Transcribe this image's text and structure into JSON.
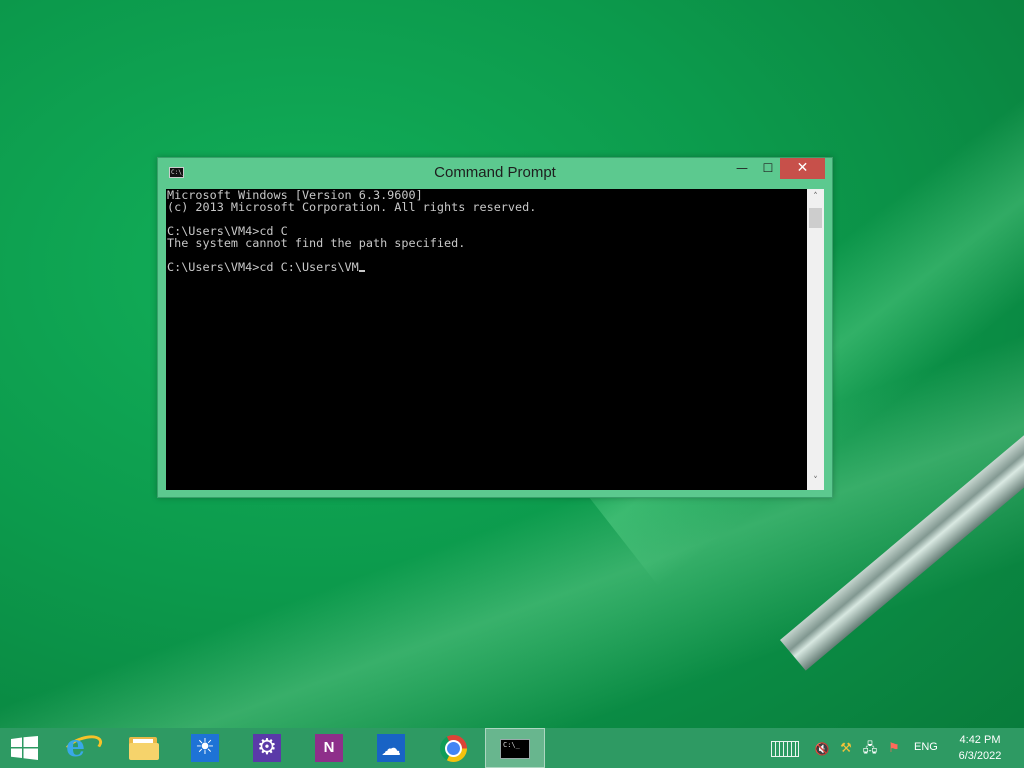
{
  "window": {
    "title": "Command Prompt",
    "controls": {
      "minimize": "—",
      "maximize": "☐",
      "close": "✕"
    }
  },
  "console": {
    "lines": [
      "Microsoft Windows [Version 6.3.9600]",
      "(c) 2013 Microsoft Corporation. All rights reserved.",
      "",
      "C:\\Users\\VM4>cd C",
      "The system cannot find the path specified.",
      "",
      "C:\\Users\\VM4>cd C:\\Users\\VM"
    ]
  },
  "scrollbar": {
    "up": "˄",
    "down": "˅"
  },
  "taskbar": {
    "icons": [
      "windows-start-icon",
      "internet-explorer-icon",
      "file-explorer-icon",
      "weather-icon",
      "settings-icon",
      "onenote-icon",
      "onedrive-icon",
      "chrome-icon",
      "command-prompt-icon"
    ],
    "onenote_label": "N",
    "cmd_icon_text": "C:\\_"
  },
  "tray": {
    "language": "ENG",
    "time": "4:42 PM",
    "date": "6/3/2022"
  },
  "colors": {
    "desktop_green": "#0c9a4c",
    "window_frame": "#5cc98f",
    "close_red": "#c7504a",
    "console_bg": "#000000",
    "console_text": "#c8c8c8"
  }
}
